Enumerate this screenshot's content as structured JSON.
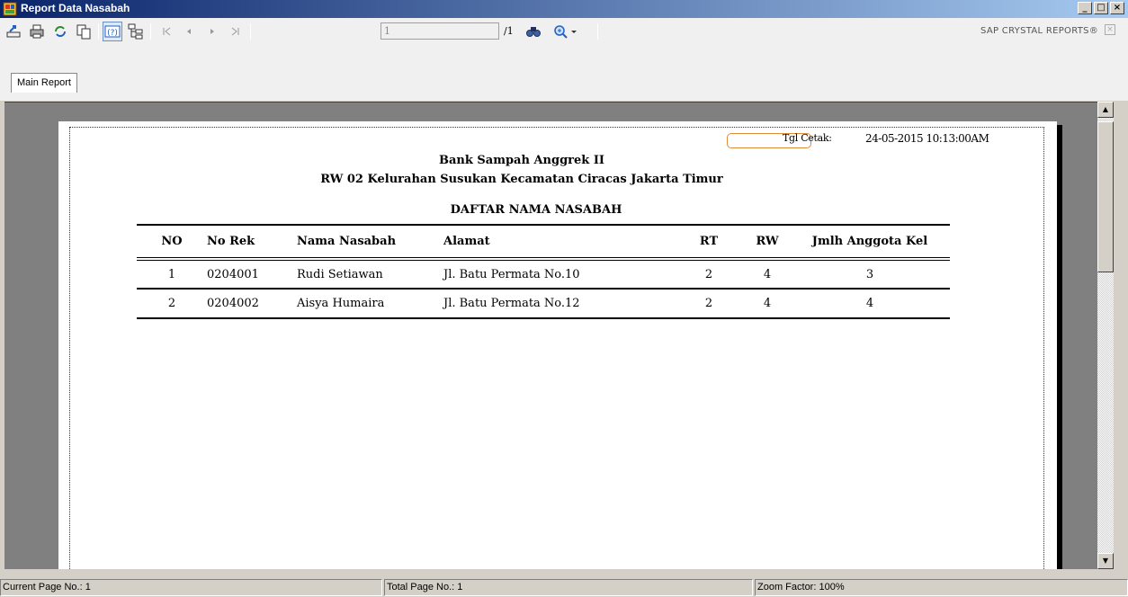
{
  "window": {
    "title": "Report Data Nasabah",
    "minimize": "_",
    "maximize": "□",
    "close": "×"
  },
  "toolbar": {
    "page_value": "1",
    "page_total": "/1",
    "brand": "SAP CRYSTAL REPORTS®",
    "icons": [
      "export-icon",
      "print-icon",
      "refresh-icon",
      "copy-icon",
      "help-icon",
      "group-tree-icon",
      "first-page-icon",
      "prev-page-icon",
      "next-page-icon",
      "last-page-icon",
      "find-icon",
      "zoom-icon"
    ]
  },
  "tabs": {
    "main": "Main Report"
  },
  "report": {
    "print_label": "Tgl Cetak:",
    "print_date": "24-05-2015 10:13:00AM",
    "header_line1": "Bank Sampah Anggrek II",
    "header_line2": "RW 02 Kelurahan Susukan Kecamatan Ciracas Jakarta Timur",
    "list_title": "DAFTAR NAMA NASABAH",
    "columns": {
      "no": "NO",
      "no_rek": "No Rek",
      "nama": "Nama Nasabah",
      "alamat": "Alamat",
      "rt": "RT",
      "rw": "RW",
      "jml": "Jmlh Anggota Kel"
    },
    "rows": [
      {
        "no": "1",
        "no_rek": "0204001",
        "nama": "Rudi Setiawan",
        "alamat": "Jl. Batu Permata No.10",
        "rt": "2",
        "rw": "4",
        "jml": "3"
      },
      {
        "no": "2",
        "no_rek": "0204002",
        "nama": "Aisya Humaira",
        "alamat": "Jl. Batu Permata No.12",
        "rt": "2",
        "rw": "4",
        "jml": "4"
      }
    ]
  },
  "status": {
    "current_page": "Current Page No.: 1",
    "total_page": "Total Page No.: 1",
    "zoom": "Zoom Factor: 100%"
  },
  "colors": {
    "title_bar": "#0a246a",
    "date_box_border": "#e08a3a"
  }
}
